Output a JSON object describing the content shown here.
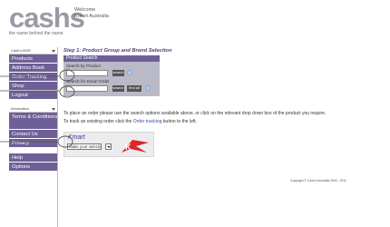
{
  "header": {
    "logo_text": "cashs",
    "tagline": "the name behind the name.",
    "welcome_line1": "Welcome",
    "welcome_line2": "Kmart Australia"
  },
  "sidebar": {
    "section1": "Cash's BOR",
    "items1": [
      "Products",
      "Address Book",
      "Order Tracking",
      "Shop",
      "Logout"
    ],
    "section2": "Information",
    "items2": [
      "Terms & Conditions",
      "Contact Us",
      "Privacy"
    ],
    "items3": [
      "Help",
      "Options"
    ]
  },
  "main": {
    "step_title": "Step 1: Product Group and Brand Selection",
    "search": {
      "header": "Product Search",
      "label_product": "Search by Product",
      "label_order": "Search for Kmart Order",
      "search_btn": "search",
      "find_all_btn": "find all"
    },
    "instruction1": "To place an order please use the search options available above, or click on the relevant drop down box of the product you require.",
    "instruction2_pre": "To track an existing order click the ",
    "instruction2_link": "Order tracking",
    "instruction2_post": " button to the left.",
    "brand": {
      "title": "Kmart",
      "select_value": "Make your selection",
      "logo_letter": "K"
    }
  },
  "footer": {
    "copyright": "Copyright © Cash's Australia 2000 - 2011"
  },
  "colors": {
    "nav_purple": "#6e5f97",
    "search_bg": "#b9b9c7",
    "kmart_red": "#e0262a",
    "link_blue": "#3b4fa6"
  }
}
